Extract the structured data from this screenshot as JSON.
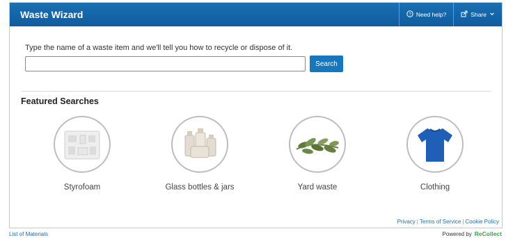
{
  "header": {
    "title": "Waste Wizard",
    "help_label": "Need help?",
    "share_label": "Share"
  },
  "search": {
    "prompt": "Type the name of a waste item and we'll tell you how to recycle or dispose of it.",
    "value": "",
    "placeholder": "",
    "button_label": "Search"
  },
  "featured": {
    "title": "Featured Searches",
    "items": [
      {
        "label": "Styrofoam"
      },
      {
        "label": "Glass bottles & jars"
      },
      {
        "label": "Yard waste"
      },
      {
        "label": "Clothing"
      }
    ]
  },
  "footer": {
    "privacy": "Privacy",
    "terms": "Terms of Service",
    "cookie": "Cookie Policy"
  },
  "below": {
    "list_link": "List of Materials",
    "powered_by": "Powered by",
    "brand": "ReCollect"
  },
  "colors": {
    "header_bg": "#1565a8",
    "accent": "#1677bd",
    "brand_green": "#3aa547"
  }
}
